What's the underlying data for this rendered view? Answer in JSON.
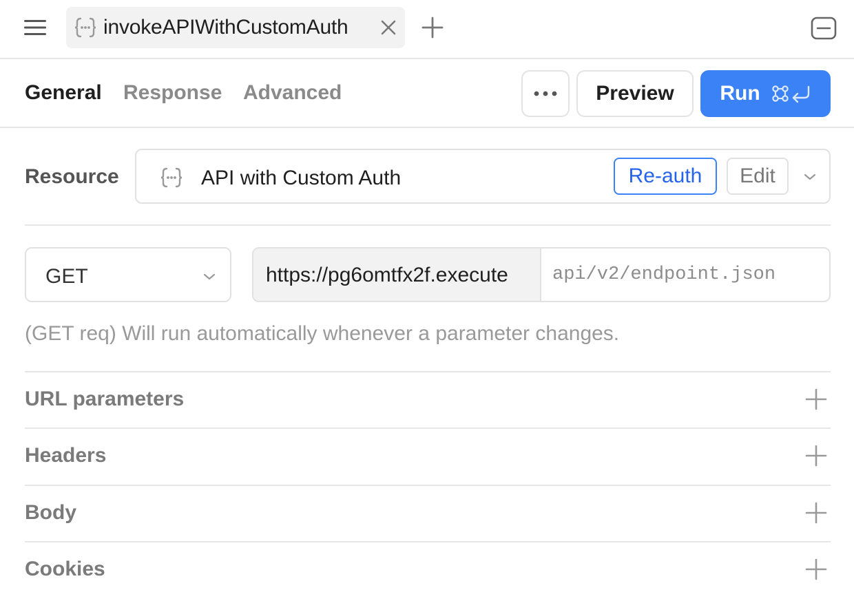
{
  "tab": {
    "title": "invokeAPIWithCustomAuth",
    "icon": "api-resource-icon"
  },
  "nav": {
    "tabs": [
      {
        "label": "General",
        "active": true
      },
      {
        "label": "Response",
        "active": false
      },
      {
        "label": "Advanced",
        "active": false
      }
    ],
    "preview_label": "Preview",
    "run_label": "Run"
  },
  "resource": {
    "label": "Resource",
    "name": "API with Custom Auth",
    "reauth_label": "Re-auth",
    "edit_label": "Edit"
  },
  "request": {
    "method": "GET",
    "base_url": "https://pg6omtfx2f.execute",
    "path_placeholder": "api/v2/endpoint.json",
    "hint": "(GET req) Will run automatically whenever a parameter changes."
  },
  "sections": [
    {
      "label": "URL parameters"
    },
    {
      "label": "Headers"
    },
    {
      "label": "Body"
    },
    {
      "label": "Cookies"
    }
  ],
  "colors": {
    "accent": "#3b82f6",
    "accent_text": "#2563eb",
    "active_tab_text": "#1f1f1f",
    "inactive_tab_text": "#8a8a8a",
    "border": "#e1e1e1"
  }
}
